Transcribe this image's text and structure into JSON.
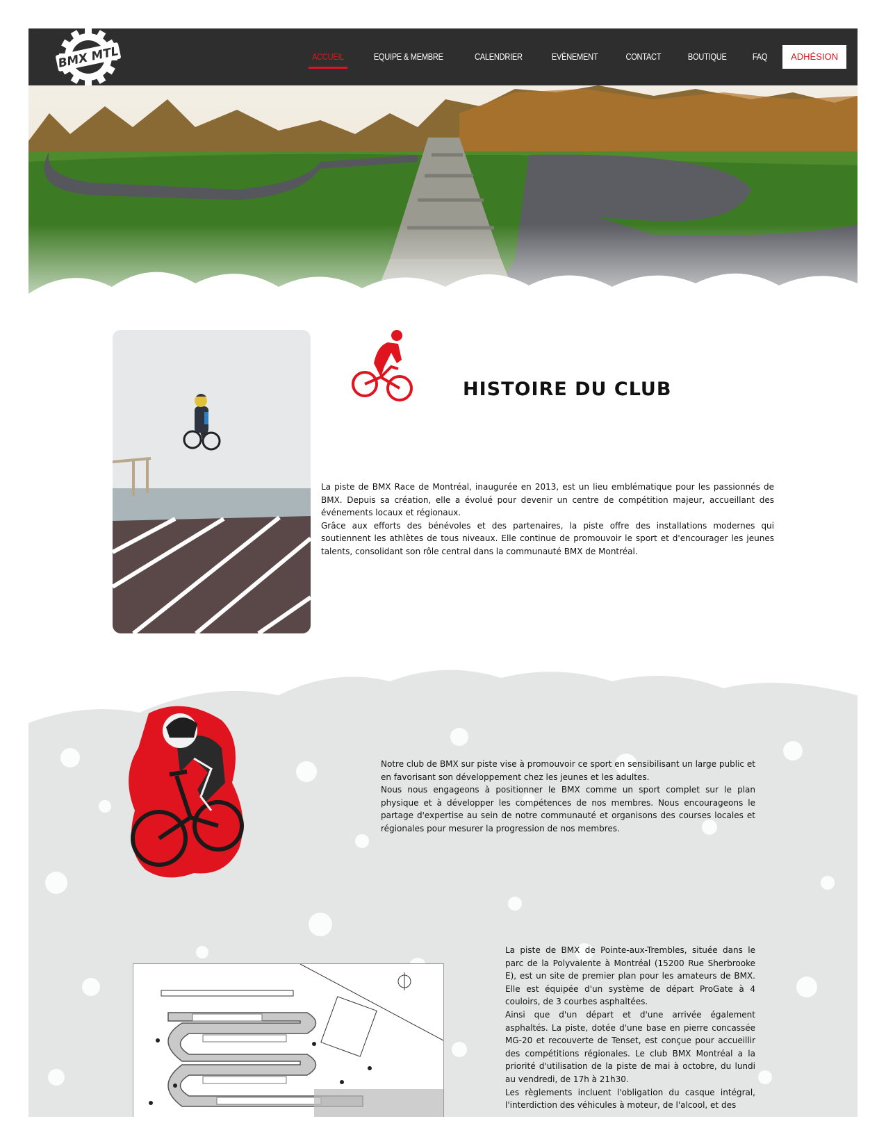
{
  "header": {
    "logo_text": "BMX MTL",
    "nav": [
      {
        "label": "ACCUEIL",
        "active": true
      },
      {
        "label": "EQUIPE & MEMBRE",
        "active": false
      },
      {
        "label": "CALENDRIER",
        "active": false
      },
      {
        "label": "EVÈNEMENT",
        "active": false
      },
      {
        "label": "CONTACT",
        "active": false
      },
      {
        "label": "BOUTIQUE",
        "active": false
      },
      {
        "label": "FAQ",
        "active": false
      }
    ],
    "cta_label": "ADHÉSION"
  },
  "colors": {
    "header_bg": "#2e2e2e",
    "accent": "#e0141e",
    "text": "#111111",
    "texture": "#e4e6e6"
  },
  "history": {
    "title": "HISTOIRE DU CLUB",
    "paragraphs": [
      "La piste de BMX Race de Montréal, inaugurée en 2013, est un lieu emblématique pour les passionnés de BMX. Depuis sa création, elle a évolué pour devenir un centre de compétition majeur, accueillant des événements locaux et régionaux.",
      "Grâce aux efforts des bénévoles et des partenaires, la piste offre des installations modernes qui soutiennent les athlètes de tous niveaux. Elle continue de promouvoir le sport et d'encourager les jeunes talents, consolidant son rôle central dans la communauté BMX de Montréal."
    ]
  },
  "mission": {
    "paragraphs": [
      "Notre club de BMX sur piste vise à promouvoir ce sport en sensibilisant un large public et en favorisant son développement chez les jeunes et les adultes.",
      "Nous nous engageons à positionner le BMX comme un sport complet sur le plan physique et à développer les compétences de nos membres. Nous encourageons le partage d'expertise au sein de notre communauté et organisons des courses locales et régionales pour mesurer la progression de nos membres."
    ]
  },
  "track": {
    "paragraphs": [
      "La piste de BMX de Pointe-aux-Trembles, située dans le parc de la Polyvalente à Montréal (15200 Rue Sherbrooke E), est un site de premier plan pour les amateurs de BMX. Elle est équipée d'un système de départ ProGate à 4 couloirs, de 3 courbes asphaltées.",
      "Ainsi que d'un départ et d'une arrivée également asphaltés. La piste, dotée d'une base en pierre concassée MG-20 et recouverte de Tenset, est conçue pour accueillir des compétitions régionales. Le club BMX Montréal a la priorité d'utilisation de la piste de mai à octobre, du lundi au vendredi, de 17h à 21h30.",
      "Les règlements incluent l'obligation du casque intégral, l'interdiction des véhicules à moteur, de l'alcool, et des"
    ]
  }
}
